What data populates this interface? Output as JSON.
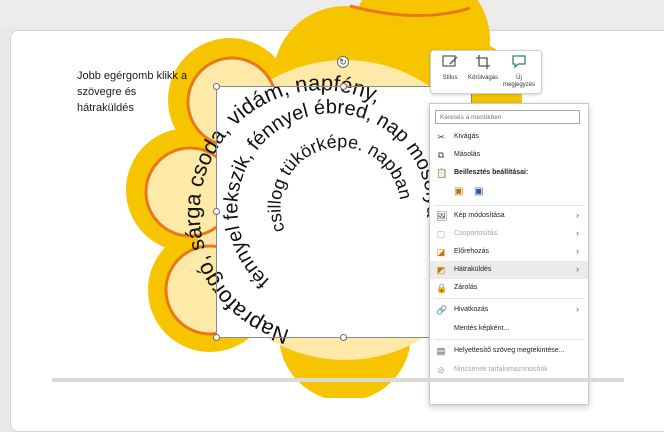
{
  "instruction": {
    "line1": "Jobb egérgomb klikk a",
    "line2": "szövegre és",
    "line3": "hátraküldés"
  },
  "spiral": {
    "outer_text": "Napraforgó, sárga csoda, vidám, napfény,",
    "middle_text": "fénnyel fekszik, fénnyel ébred, nap mosolya",
    "inner_text": "csillog tükörképe. napban"
  },
  "mini_toolbar": {
    "style_label": "Stílus",
    "crop_label": "Körülvágás",
    "comment_label_1": "Új",
    "comment_label_2": "megjegyzés"
  },
  "context_menu": {
    "search_placeholder": "Keresés a menükben",
    "items": [
      {
        "label": "Kivágás",
        "icon": "scissors-icon"
      },
      {
        "label": "Másolás",
        "icon": "copy-icon"
      },
      {
        "label": "Beillesztés beállításai:",
        "icon": "paste-icon"
      },
      {
        "label": "Kép módosítása",
        "icon": "change-picture-icon"
      },
      {
        "label": "Csoportosítás",
        "icon": "group-icon"
      },
      {
        "label": "Előrehozás",
        "icon": "bring-forward-icon"
      },
      {
        "label": "Hátraküldés",
        "icon": "send-backward-icon"
      },
      {
        "label": "Zárolás",
        "icon": "lock-icon"
      },
      {
        "label": "Hivatkozás",
        "icon": "link-icon"
      },
      {
        "label": "Mentés képként...",
        "icon": ""
      },
      {
        "label": "Helyettesítő szöveg megtekintése...",
        "icon": "alt-text-icon"
      },
      {
        "label": "Nincsenek tartalomazonosítók",
        "icon": "content-id-icon"
      }
    ]
  },
  "colors": {
    "flower_outer": "#f7c400",
    "flower_inner": "#ffe9a8",
    "flower_edge": "#e8781a",
    "highlight": "#ebebeb"
  }
}
